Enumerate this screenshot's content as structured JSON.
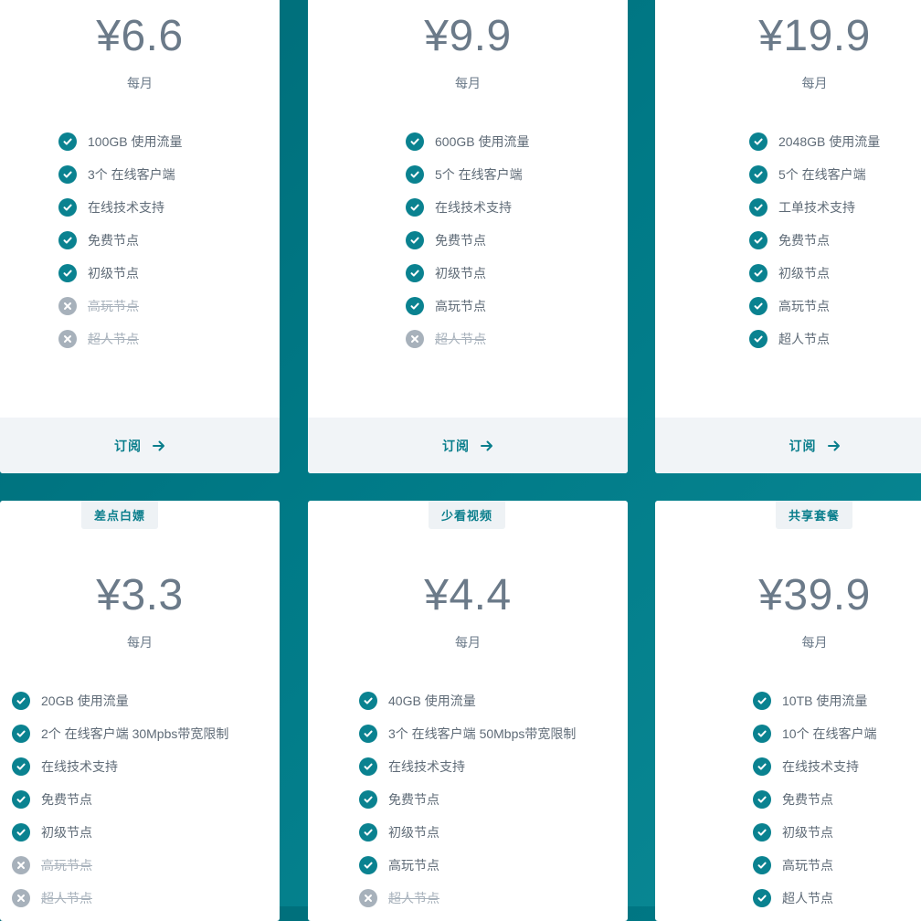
{
  "colors": {
    "accent": "#0a8290",
    "disabled": "#a7b1bb",
    "background": "#007a87"
  },
  "subscribe_label": "订阅",
  "plans": [
    {
      "tag": "",
      "price": "¥6.6",
      "period": "每月",
      "features": [
        {
          "text": "100GB 使用流量",
          "included": true
        },
        {
          "text": "3个 在线客户端",
          "included": true
        },
        {
          "text": "在线技术支持",
          "included": true
        },
        {
          "text": "免费节点",
          "included": true
        },
        {
          "text": "初级节点",
          "included": true
        },
        {
          "text": "高玩节点",
          "included": false
        },
        {
          "text": "超人节点",
          "included": false
        }
      ]
    },
    {
      "tag": "",
      "price": "¥9.9",
      "period": "每月",
      "features": [
        {
          "text": "600GB 使用流量",
          "included": true
        },
        {
          "text": "5个 在线客户端",
          "included": true
        },
        {
          "text": "在线技术支持",
          "included": true
        },
        {
          "text": "免费节点",
          "included": true
        },
        {
          "text": "初级节点",
          "included": true
        },
        {
          "text": "高玩节点",
          "included": true
        },
        {
          "text": "超人节点",
          "included": false
        }
      ]
    },
    {
      "tag": "",
      "price": "¥19.9",
      "period": "每月",
      "features": [
        {
          "text": "2048GB 使用流量",
          "included": true
        },
        {
          "text": "5个 在线客户端",
          "included": true
        },
        {
          "text": "工单技术支持",
          "included": true
        },
        {
          "text": "免费节点",
          "included": true
        },
        {
          "text": "初级节点",
          "included": true
        },
        {
          "text": "高玩节点",
          "included": true
        },
        {
          "text": "超人节点",
          "included": true
        }
      ]
    },
    {
      "tag": "差点白嫖",
      "price": "¥3.3",
      "period": "每月",
      "features": [
        {
          "text": "20GB 使用流量",
          "included": true
        },
        {
          "text": "2个 在线客户端 30Mpbs带宽限制",
          "included": true
        },
        {
          "text": "在线技术支持",
          "included": true
        },
        {
          "text": "免费节点",
          "included": true
        },
        {
          "text": "初级节点",
          "included": true
        },
        {
          "text": "高玩节点",
          "included": false
        },
        {
          "text": "超人节点",
          "included": false
        }
      ]
    },
    {
      "tag": "少看视频",
      "price": "¥4.4",
      "period": "每月",
      "features": [
        {
          "text": "40GB 使用流量",
          "included": true
        },
        {
          "text": "3个 在线客户端 50Mbps带宽限制",
          "included": true
        },
        {
          "text": "在线技术支持",
          "included": true
        },
        {
          "text": "免费节点",
          "included": true
        },
        {
          "text": "初级节点",
          "included": true
        },
        {
          "text": "高玩节点",
          "included": true
        },
        {
          "text": "超人节点",
          "included": false
        }
      ]
    },
    {
      "tag": "共享套餐",
      "price": "¥39.9",
      "period": "每月",
      "features": [
        {
          "text": "10TB 使用流量",
          "included": true
        },
        {
          "text": "10个 在线客户端",
          "included": true
        },
        {
          "text": "在线技术支持",
          "included": true
        },
        {
          "text": "免费节点",
          "included": true
        },
        {
          "text": "初级节点",
          "included": true
        },
        {
          "text": "高玩节点",
          "included": true
        },
        {
          "text": "超人节点",
          "included": true
        }
      ]
    }
  ]
}
